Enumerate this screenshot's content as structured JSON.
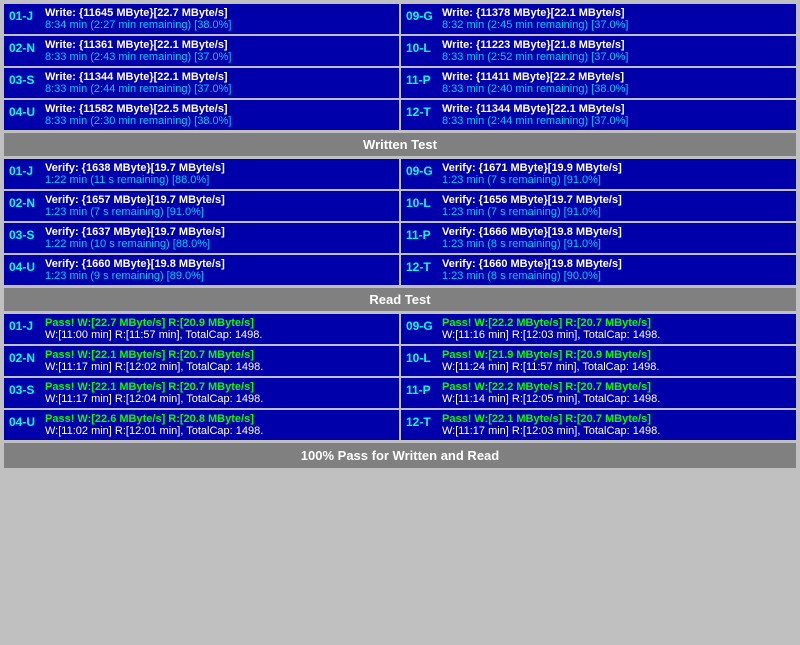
{
  "sections": {
    "write": {
      "header": "Written Test",
      "left": [
        {
          "label": "01-J",
          "line1": "Write: {11645 MByte}[22.7 MByte/s]",
          "line2": "8:34 min (2:27 min remaining)  [38.0%]"
        },
        {
          "label": "02-N",
          "line1": "Write: {11361 MByte}[22.1 MByte/s]",
          "line2": "8:33 min (2:43 min remaining)  [37.0%]"
        },
        {
          "label": "03-S",
          "line1": "Write: {11344 MByte}[22.1 MByte/s]",
          "line2": "8:33 min (2:44 min remaining)  [37.0%]"
        },
        {
          "label": "04-U",
          "line1": "Write: {11582 MByte}[22.5 MByte/s]",
          "line2": "8:33 min (2:30 min remaining)  [38.0%]"
        }
      ],
      "right": [
        {
          "label": "09-G",
          "line1": "Write: {11378 MByte}[22.1 MByte/s]",
          "line2": "8:32 min (2:45 min remaining)  [37.0%]"
        },
        {
          "label": "10-L",
          "line1": "Write: {11223 MByte}[21.8 MByte/s]",
          "line2": "8:33 min (2:52 min remaining)  [37.0%]"
        },
        {
          "label": "11-P",
          "line1": "Write: {11411 MByte}[22.2 MByte/s]",
          "line2": "8:33 min (2:40 min remaining)  [38.0%]"
        },
        {
          "label": "12-T",
          "line1": "Write: {11344 MByte}[22.1 MByte/s]",
          "line2": "8:33 min (2:44 min remaining)  [37.0%]"
        }
      ]
    },
    "verify": {
      "header": "Written Test",
      "left": [
        {
          "label": "01-J",
          "line1": "Verify: {1638 MByte}[19.7 MByte/s]",
          "line2": "1:22 min (11 s remaining)   [88.0%]"
        },
        {
          "label": "02-N",
          "line1": "Verify: {1657 MByte}[19.7 MByte/s]",
          "line2": "1:23 min (7 s remaining)   [91.0%]"
        },
        {
          "label": "03-S",
          "line1": "Verify: {1637 MByte}[19.7 MByte/s]",
          "line2": "1:22 min (10 s remaining)   [88.0%]"
        },
        {
          "label": "04-U",
          "line1": "Verify: {1660 MByte}[19.8 MByte/s]",
          "line2": "1:23 min (9 s remaining)   [89.0%]"
        }
      ],
      "right": [
        {
          "label": "09-G",
          "line1": "Verify: {1671 MByte}[19.9 MByte/s]",
          "line2": "1:23 min (7 s remaining)   [91.0%]"
        },
        {
          "label": "10-L",
          "line1": "Verify: {1656 MByte}[19.7 MByte/s]",
          "line2": "1:23 min (7 s remaining)   [91.0%]"
        },
        {
          "label": "11-P",
          "line1": "Verify: {1666 MByte}[19.8 MByte/s]",
          "line2": "1:23 min (8 s remaining)   [91.0%]"
        },
        {
          "label": "12-T",
          "line1": "Verify: {1660 MByte}[19.8 MByte/s]",
          "line2": "1:23 min (8 s remaining)   [90.0%]"
        }
      ]
    },
    "read": {
      "header": "Read Test",
      "left": [
        {
          "label": "01-J",
          "line1": "Pass! W:[22.7 MByte/s] R:[20.9 MByte/s]",
          "line2": "W:[11:00 min] R:[11:57 min], TotalCap: 1498."
        },
        {
          "label": "02-N",
          "line1": "Pass! W:[22.1 MByte/s] R:[20.7 MByte/s]",
          "line2": "W:[11:17 min] R:[12:02 min], TotalCap: 1498."
        },
        {
          "label": "03-S",
          "line1": "Pass! W:[22.1 MByte/s] R:[20.7 MByte/s]",
          "line2": "W:[11:17 min] R:[12:04 min], TotalCap: 1498."
        },
        {
          "label": "04-U",
          "line1": "Pass! W:[22.6 MByte/s] R:[20.8 MByte/s]",
          "line2": "W:[11:02 min] R:[12:01 min], TotalCap: 1498."
        }
      ],
      "right": [
        {
          "label": "09-G",
          "line1": "Pass! W:[22.2 MByte/s] R:[20.7 MByte/s]",
          "line2": "W:[11:16 min] R:[12:03 min], TotalCap: 1498."
        },
        {
          "label": "10-L",
          "line1": "Pass! W:[21.9 MByte/s] R:[20.9 MByte/s]",
          "line2": "W:[11:24 min] R:[11:57 min], TotalCap: 1498."
        },
        {
          "label": "11-P",
          "line1": "Pass! W:[22.2 MByte/s] R:[20.7 MByte/s]",
          "line2": "W:[11:14 min] R:[12:05 min], TotalCap: 1498."
        },
        {
          "label": "12-T",
          "line1": "Pass! W:[22.1 MByte/s] R:[20.7 MByte/s]",
          "line2": "W:[11:17 min] R:[12:03 min], TotalCap: 1498."
        }
      ]
    }
  },
  "write_header": "Written Test",
  "read_header": "Read Test",
  "footer": "100% Pass for Written and Read"
}
